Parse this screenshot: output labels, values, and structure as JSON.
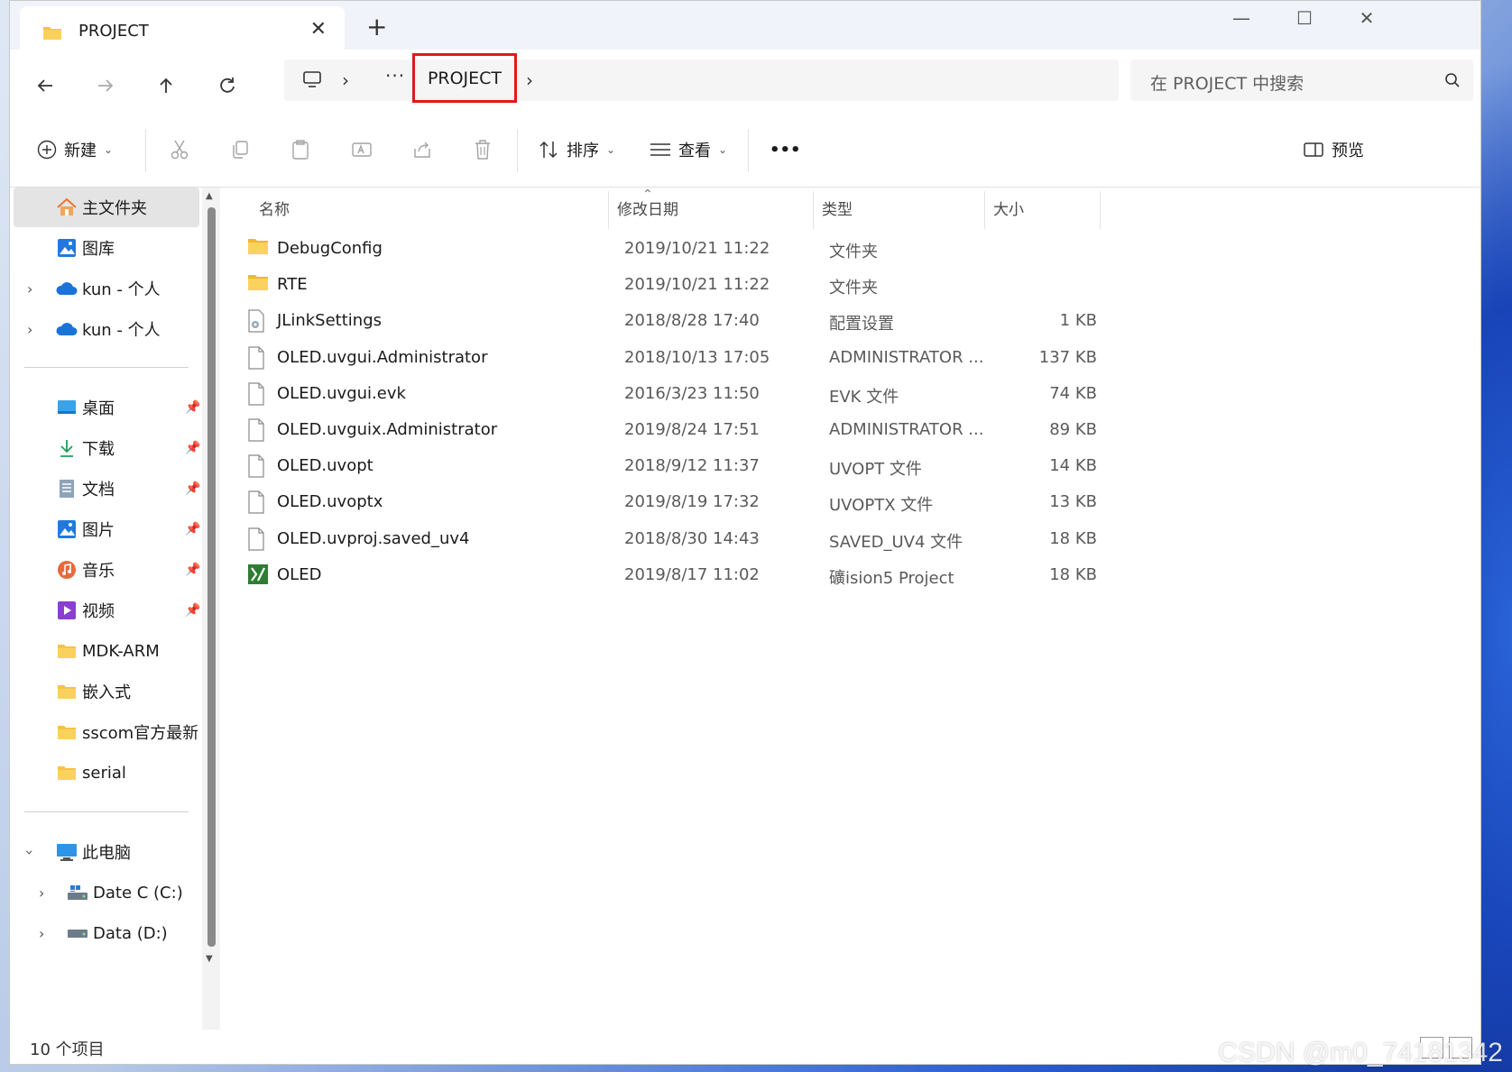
{
  "window": {
    "tab_title": "PROJECT",
    "new_tab_label": "+",
    "controls": {
      "minimize": "—",
      "maximize": "☐",
      "close": "✕"
    }
  },
  "nav": {
    "breadcrumb_current": "PROJECT",
    "search_placeholder": "在 PROJECT 中搜索"
  },
  "commands": {
    "new_label": "新建",
    "sort_label": "排序",
    "view_label": "查看",
    "more_label": "•••",
    "preview_label": "预览"
  },
  "sidebar": {
    "quick": [
      {
        "label": "主文件夹",
        "icon": "home-icon"
      },
      {
        "label": "图库",
        "icon": "gallery-icon"
      },
      {
        "label": "kun - 个人",
        "icon": "onedrive-cloud-icon"
      },
      {
        "label": "kun - 个人",
        "icon": "onedrive-cloud-icon"
      }
    ],
    "pinned": [
      {
        "label": "桌面",
        "icon": "desktop-icon"
      },
      {
        "label": "下载",
        "icon": "download-icon"
      },
      {
        "label": "文档",
        "icon": "documents-icon"
      },
      {
        "label": "图片",
        "icon": "pictures-icon"
      },
      {
        "label": "音乐",
        "icon": "music-icon"
      },
      {
        "label": "视频",
        "icon": "videos-icon"
      },
      {
        "label": "MDK-ARM",
        "icon": "folder-icon"
      },
      {
        "label": "嵌入式",
        "icon": "folder-icon"
      },
      {
        "label": "sscom官方最新(",
        "icon": "folder-icon"
      },
      {
        "label": "serial",
        "icon": "folder-icon"
      }
    ],
    "pc": {
      "label": "此电脑"
    },
    "drives": [
      {
        "label": "Date C (C:)"
      },
      {
        "label": "Data (D:)"
      }
    ]
  },
  "columns": {
    "name": "名称",
    "modified": "修改日期",
    "type": "类型",
    "size": "大小"
  },
  "files": [
    {
      "name": "DebugConfig",
      "modified": "2019/10/21 11:22",
      "type": "文件夹",
      "size": "",
      "icon": "folder-icon"
    },
    {
      "name": "RTE",
      "modified": "2019/10/21 11:22",
      "type": "文件夹",
      "size": "",
      "icon": "folder-icon"
    },
    {
      "name": "JLinkSettings",
      "modified": "2018/8/28 17:40",
      "type": "配置设置",
      "size": "1 KB",
      "icon": "settings-file-icon"
    },
    {
      "name": "OLED.uvgui.Administrator",
      "modified": "2018/10/13 17:05",
      "type": "ADMINISTRATOR ...",
      "size": "137 KB",
      "icon": "file-icon"
    },
    {
      "name": "OLED.uvgui.evk",
      "modified": "2016/3/23 11:50",
      "type": "EVK 文件",
      "size": "74 KB",
      "icon": "file-icon"
    },
    {
      "name": "OLED.uvguix.Administrator",
      "modified": "2019/8/24 17:51",
      "type": "ADMINISTRATOR ...",
      "size": "89 KB",
      "icon": "file-icon"
    },
    {
      "name": "OLED.uvopt",
      "modified": "2018/9/12 11:37",
      "type": "UVOPT 文件",
      "size": "14 KB",
      "icon": "file-icon"
    },
    {
      "name": "OLED.uvoptx",
      "modified": "2019/8/19 17:32",
      "type": "UVOPTX 文件",
      "size": "13 KB",
      "icon": "file-icon"
    },
    {
      "name": "OLED.uvproj.saved_uv4",
      "modified": "2018/8/30 14:43",
      "type": "SAVED_UV4 文件",
      "size": "18 KB",
      "icon": "file-icon"
    },
    {
      "name": "OLED",
      "modified": "2019/8/17 11:02",
      "type": "礦ision5 Project",
      "size": "18 KB",
      "icon": "keil-project-icon"
    }
  ],
  "status": {
    "item_count": "10 个项目"
  },
  "watermark": "CSDN @m0_74181342",
  "colors": {
    "highlight_box": "#e0191c",
    "selected_nav": "#e4e4e4",
    "folder": "#f7c244"
  }
}
